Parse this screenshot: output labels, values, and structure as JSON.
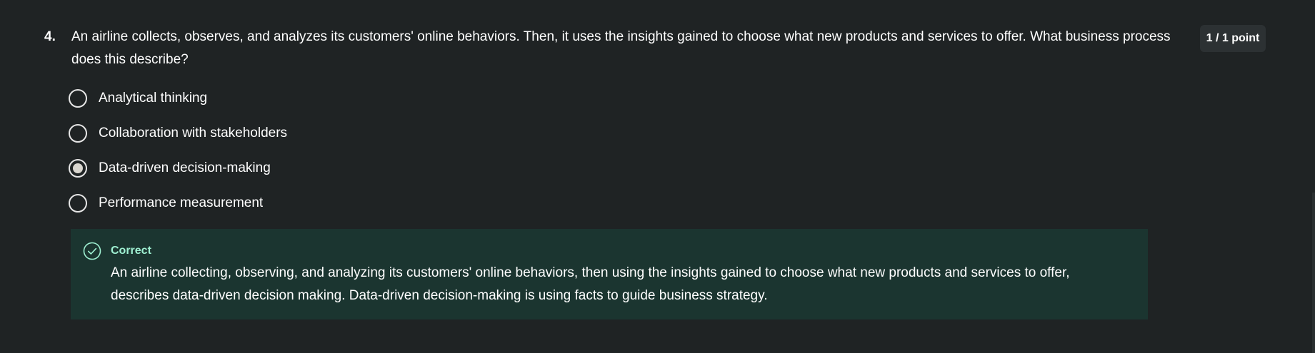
{
  "question": {
    "number": "4.",
    "text": "An airline collects, observes, and analyzes its customers' online behaviors. Then, it uses the insights gained to choose what new products and services to offer. What business process does this describe?",
    "points": "1 / 1 point"
  },
  "options": [
    {
      "label": "Analytical thinking",
      "selected": false
    },
    {
      "label": "Collaboration with stakeholders",
      "selected": false
    },
    {
      "label": "Data-driven decision-making",
      "selected": true
    },
    {
      "label": "Performance measurement",
      "selected": false
    }
  ],
  "feedback": {
    "title": "Correct",
    "text": "An airline collecting, observing, and analyzing its customers' online behaviors, then using the insights gained to choose what new products and services to offer, describes data-driven decision making. Data-driven decision-making is using facts to guide business strategy.",
    "icon": "check-circle-icon",
    "accent_color": "#9ff0d2",
    "background_color": "#1b3530"
  },
  "colors": {
    "page_background": "#1f2324",
    "badge_background": "#2c3133"
  }
}
